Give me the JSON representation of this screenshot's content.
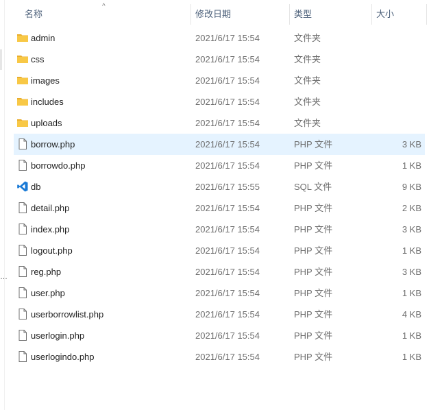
{
  "columns": {
    "name": "名称",
    "date": "修改日期",
    "type": "类型",
    "size": "大小"
  },
  "colors": {
    "folder": "#f8c846",
    "selected_row": "#e5f3ff",
    "vscode_icon": "#1a7ad6"
  },
  "files": [
    {
      "name": "admin",
      "date": "2021/6/17 15:54",
      "type": "文件夹",
      "size": "",
      "icon": "folder-icon"
    },
    {
      "name": "css",
      "date": "2021/6/17 15:54",
      "type": "文件夹",
      "size": "",
      "icon": "folder-icon"
    },
    {
      "name": "images",
      "date": "2021/6/17 15:54",
      "type": "文件夹",
      "size": "",
      "icon": "folder-icon"
    },
    {
      "name": "includes",
      "date": "2021/6/17 15:54",
      "type": "文件夹",
      "size": "",
      "icon": "folder-icon"
    },
    {
      "name": "uploads",
      "date": "2021/6/17 15:54",
      "type": "文件夹",
      "size": "",
      "icon": "folder-icon"
    },
    {
      "name": "borrow.php",
      "date": "2021/6/17 15:54",
      "type": "PHP 文件",
      "size": "3 KB",
      "icon": "file-icon",
      "selected": true
    },
    {
      "name": "borrowdo.php",
      "date": "2021/6/17 15:54",
      "type": "PHP 文件",
      "size": "1 KB",
      "icon": "file-icon"
    },
    {
      "name": "db",
      "date": "2021/6/17 15:55",
      "type": "SQL 文件",
      "size": "9 KB",
      "icon": "vscode-icon"
    },
    {
      "name": "detail.php",
      "date": "2021/6/17 15:54",
      "type": "PHP 文件",
      "size": "2 KB",
      "icon": "file-icon"
    },
    {
      "name": "index.php",
      "date": "2021/6/17 15:54",
      "type": "PHP 文件",
      "size": "3 KB",
      "icon": "file-icon"
    },
    {
      "name": "logout.php",
      "date": "2021/6/17 15:54",
      "type": "PHP 文件",
      "size": "1 KB",
      "icon": "file-icon"
    },
    {
      "name": "reg.php",
      "date": "2021/6/17 15:54",
      "type": "PHP 文件",
      "size": "3 KB",
      "icon": "file-icon"
    },
    {
      "name": "user.php",
      "date": "2021/6/17 15:54",
      "type": "PHP 文件",
      "size": "1 KB",
      "icon": "file-icon"
    },
    {
      "name": "userborrowlist.php",
      "date": "2021/6/17 15:54",
      "type": "PHP 文件",
      "size": "4 KB",
      "icon": "file-icon"
    },
    {
      "name": "userlogin.php",
      "date": "2021/6/17 15:54",
      "type": "PHP 文件",
      "size": "1 KB",
      "icon": "file-icon"
    },
    {
      "name": "userlogindo.php",
      "date": "2021/6/17 15:54",
      "type": "PHP 文件",
      "size": "1 KB",
      "icon": "file-icon"
    }
  ]
}
